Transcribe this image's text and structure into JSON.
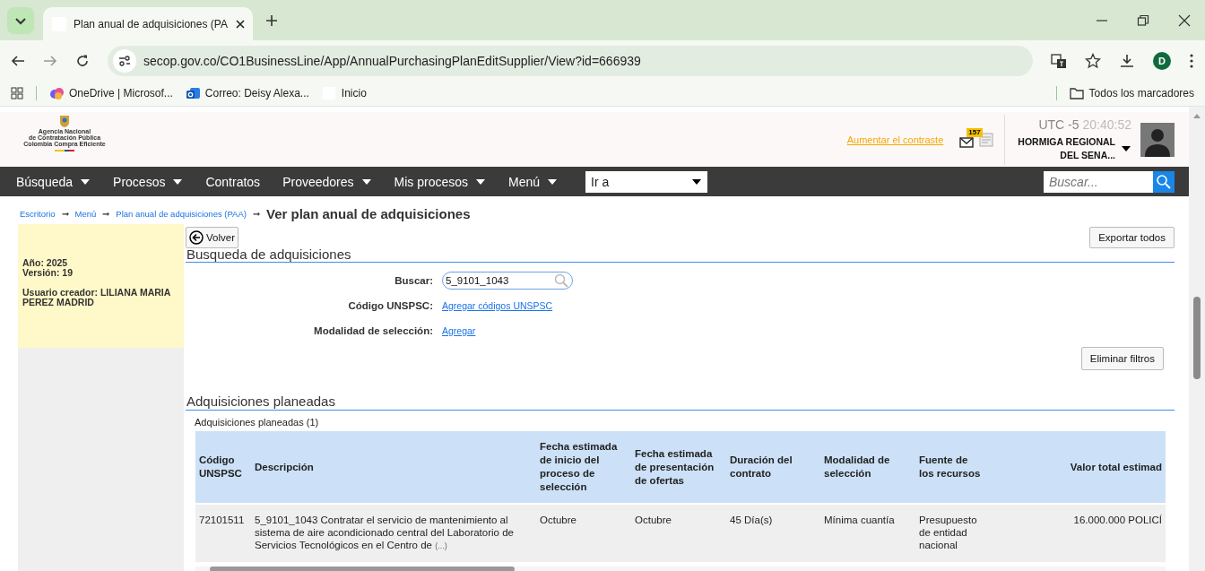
{
  "browser": {
    "tabs": [
      {
        "title": "Plan anual de adquisiciones (PA",
        "selected": true
      }
    ],
    "url": "secop.gov.co/CO1BusinessLine/App/AnnualPurchasingPlanEditSupplier/View?id=666939",
    "profile_initial": "D",
    "bookmarks": [
      {
        "label": "OneDrive | Microsof...",
        "kind": "onedrive"
      },
      {
        "label": "Correo: Deisy Alexa...",
        "kind": "outlook"
      },
      {
        "label": "Inicio",
        "kind": "blank"
      }
    ],
    "all_bookmarks": "Todos los marcadores"
  },
  "header": {
    "logo_lines": [
      "Agencia Nacional",
      "de Contratación Pública",
      "Colombia Compra Eficiente"
    ],
    "contrast_link": "Aumentar el contraste",
    "mail_count": "157",
    "timezone": "UTC -5",
    "time": "20:40:52",
    "user_lines": [
      "HORMIGA REGIONAL",
      "DEL SENA..."
    ]
  },
  "nav": {
    "items": [
      {
        "label": "Búsqueda",
        "dropdown": true
      },
      {
        "label": "Procesos",
        "dropdown": true
      },
      {
        "label": "Contratos",
        "dropdown": false
      },
      {
        "label": "Proveedores",
        "dropdown": true
      },
      {
        "label": "Mis procesos",
        "dropdown": true
      },
      {
        "label": "Menú",
        "dropdown": true
      }
    ],
    "goto": "Ir a",
    "search_placeholder": "Buscar..."
  },
  "breadcrumb": {
    "links": [
      "Escritorio",
      "Menú",
      "Plan anual de adquisiciones (PAA)"
    ],
    "separator": "➞",
    "current": "Ver plan anual de adquisiciones"
  },
  "sidebar": {
    "lines": [
      "Año: 2025",
      "Versión: 19"
    ],
    "creator": "Usuario creador: LILIANA MARIA PEREZ MADRID"
  },
  "back_button": "Volver",
  "export_button": "Exportar todos",
  "search_section": {
    "title": "Busqueda de adquisiciones",
    "fields": [
      {
        "label": "Buscar:",
        "kind": "input",
        "value": "5_9101_1043"
      },
      {
        "label": "Código UNSPSC:",
        "kind": "link",
        "link": "Agregar códigos UNSPSC"
      },
      {
        "label": "Modalidad de selección:",
        "kind": "link",
        "link": "Agregar"
      }
    ],
    "clear_button": "Eliminar filtros"
  },
  "planned": {
    "title": "Adquisiciones planeadas",
    "caption": "Adquisiciones planeadas (1)",
    "columns": [
      "Código UNSPSC",
      "Descripción",
      "Fecha estimada de inicio del proceso de selección",
      "Fecha estimada de presentación de ofertas",
      "Duración del contrato",
      "Modalidad de selección",
      "Fuente de los recursos",
      "Valor total estimad"
    ],
    "rows": [
      {
        "cells": [
          "72101511",
          "5_9101_1043 Contratar el servicio de mantenimiento al sistema de aire acondicionado central del Laboratorio de Servicios Tecnológicos en el Centro de",
          "Octubre",
          "Octubre",
          "45 Día(s)",
          "Mínima cuantía",
          "Presupuesto de entidad nacional",
          "16.000.000 POLICÍ"
        ],
        "more": "(...)"
      }
    ]
  }
}
